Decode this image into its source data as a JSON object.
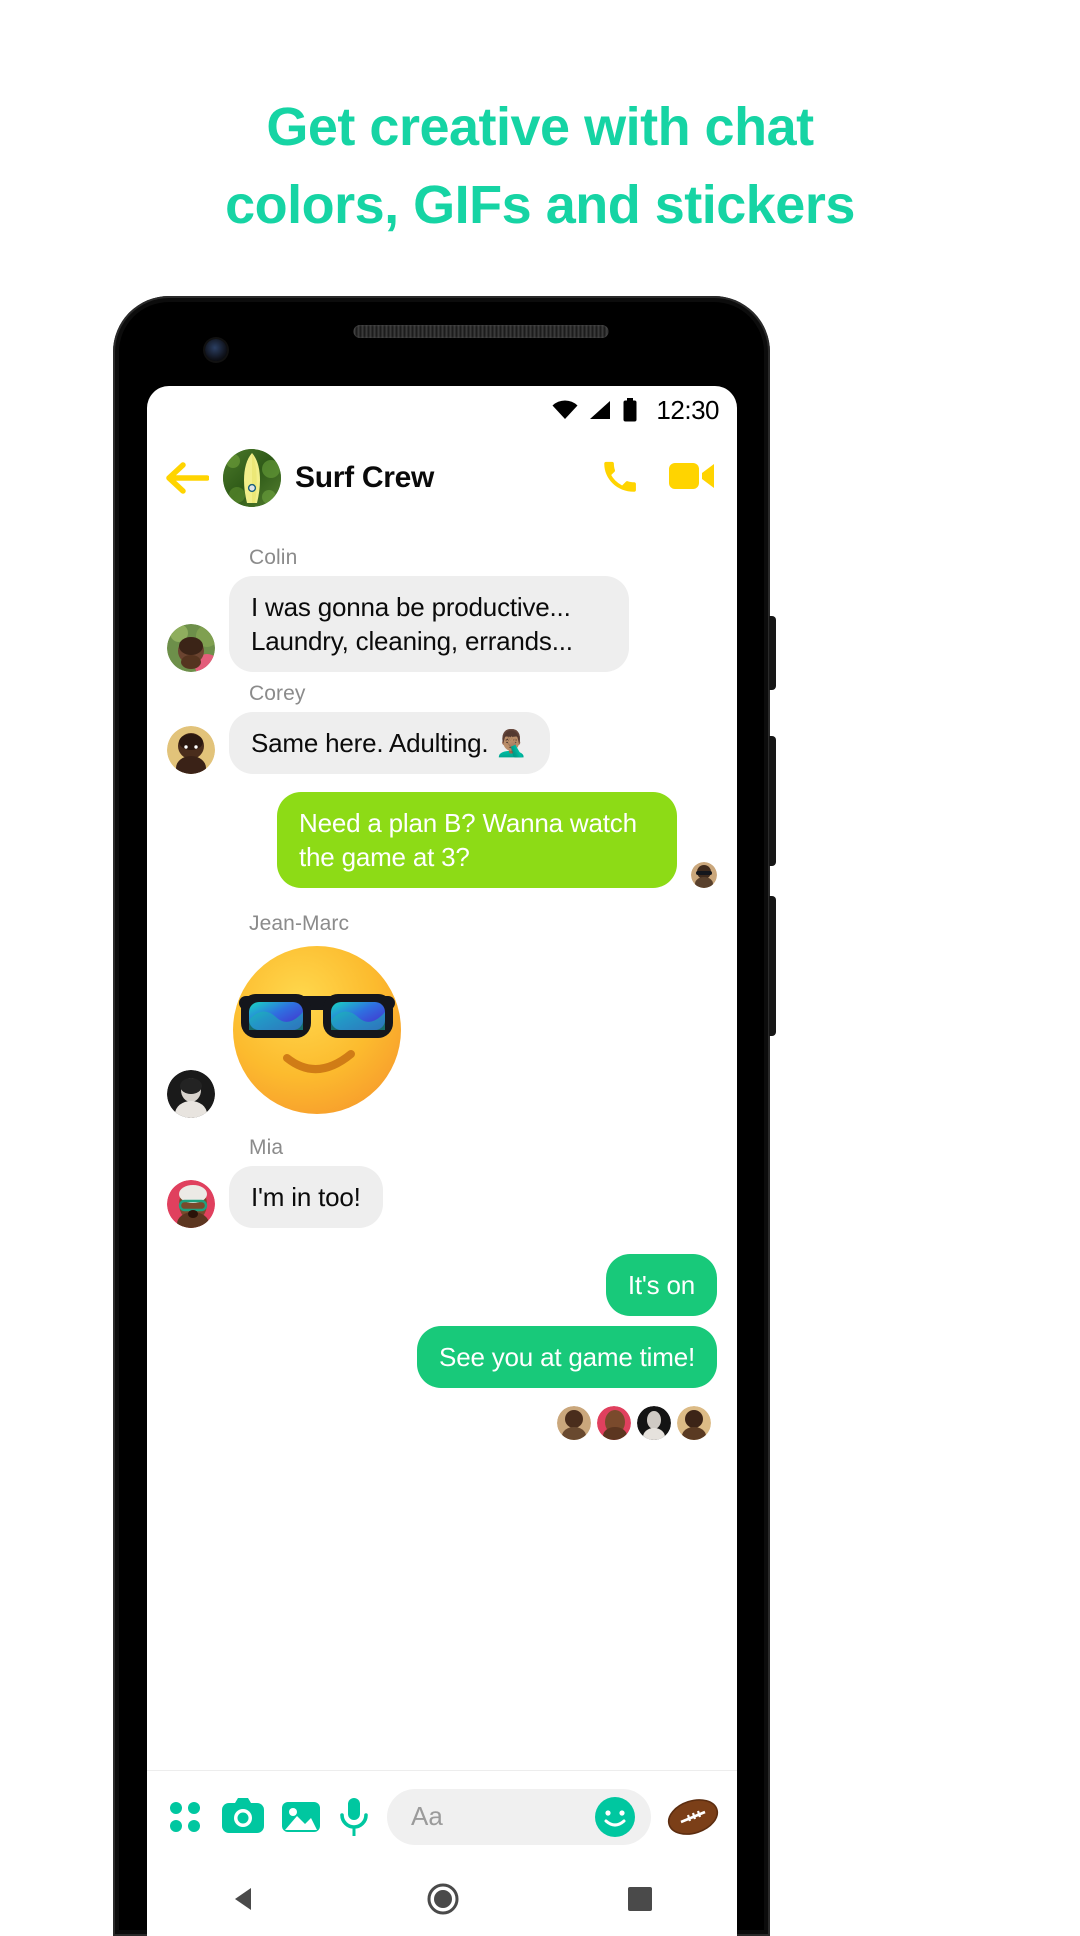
{
  "headline": {
    "line1": "Get creative with chat",
    "line2": "colors, GIFs and stickers",
    "color": "#16d4a4"
  },
  "status_bar": {
    "time": "12:30",
    "icons": [
      "wifi-icon",
      "cellular-signal-icon",
      "battery-icon"
    ]
  },
  "conversation_header": {
    "back_label": "Back",
    "title": "Surf Crew",
    "audio_call_label": "Audio call",
    "video_call_label": "Video call",
    "accent_color": "#ffd400"
  },
  "messages": [
    {
      "id": "m1",
      "sender": "Colin",
      "direction": "incoming",
      "type": "text",
      "text": "I was gonna be productive... Laundry, cleaning, errands..."
    },
    {
      "id": "m2",
      "sender": "Corey",
      "direction": "incoming",
      "type": "text",
      "text": "Same here. Adulting. 🤦🏽‍♂️"
    },
    {
      "id": "m3",
      "sender": "",
      "direction": "outgoing",
      "type": "text",
      "text": "Need a plan B? Wanna watch the game at 3?",
      "bubble_color": "#8ddb16"
    },
    {
      "id": "m4",
      "sender": "Jean-Marc",
      "direction": "incoming",
      "type": "sticker",
      "sticker_name": "sunglasses-smiley-sticker",
      "text": ""
    },
    {
      "id": "m5",
      "sender": "Mia",
      "direction": "incoming",
      "type": "text",
      "text": "I'm in too!"
    },
    {
      "id": "m6",
      "sender": "",
      "direction": "outgoing",
      "type": "text",
      "text": "It's on",
      "bubble_color": "#18c97a"
    },
    {
      "id": "m7",
      "sender": "",
      "direction": "outgoing",
      "type": "text",
      "text": "See you at game time!",
      "bubble_color": "#18c97a"
    }
  ],
  "seen_by": [
    {
      "name": "seen-avatar-1"
    },
    {
      "name": "seen-avatar-2"
    },
    {
      "name": "seen-avatar-3"
    },
    {
      "name": "seen-avatar-4"
    }
  ],
  "composer": {
    "placeholder": "Aa",
    "icons": [
      "app-grid-icon",
      "camera-icon",
      "gallery-icon",
      "microphone-icon",
      "emoji-icon",
      "football-sticker-icon"
    ],
    "accent_color": "#00c7a0"
  },
  "nav_bar": {
    "back_label": "Back",
    "home_label": "Home",
    "recents_label": "Recent apps"
  }
}
